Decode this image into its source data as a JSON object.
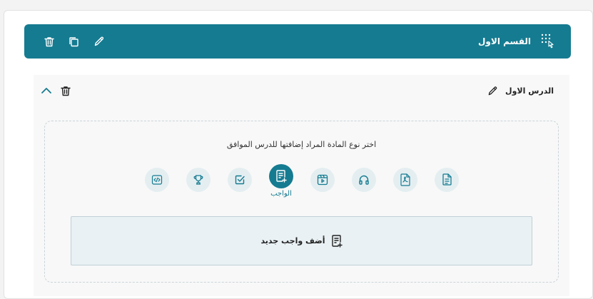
{
  "section": {
    "title": "القسم الاول",
    "icons": [
      "drag-handle-icon",
      "edit-icon",
      "copy-icon",
      "trash-icon"
    ]
  },
  "lesson": {
    "title": "الدرس الاول",
    "prompt": "اختر نوع المادة المراد إضافتها للدرس الموافق",
    "types": [
      {
        "icon": "code-icon",
        "label": ""
      },
      {
        "icon": "trophy-icon",
        "label": ""
      },
      {
        "icon": "checkbox-icon",
        "label": ""
      },
      {
        "icon": "homework-icon",
        "label": "الواجب",
        "active": true
      },
      {
        "icon": "video-icon",
        "label": ""
      },
      {
        "icon": "headphones-icon",
        "label": ""
      },
      {
        "icon": "pdf-icon",
        "label": ""
      },
      {
        "icon": "document-icon",
        "label": ""
      }
    ],
    "add_label": "أضف واجب جديد"
  },
  "colors": {
    "primary": "#157b91",
    "icon_bg": "#e4eef1",
    "add_bg": "#e9f1f4"
  }
}
